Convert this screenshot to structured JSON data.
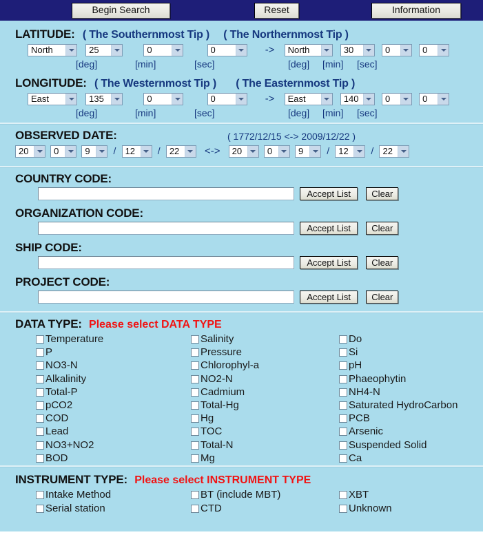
{
  "toolbar": {
    "begin_search": "Begin Search",
    "reset": "Reset",
    "information": "Information"
  },
  "latitude": {
    "label": "LATITUDE:",
    "from_tip": "( The Southernmost Tip )",
    "to_tip": "( The Northernmost Tip )",
    "arrow": "->",
    "from": {
      "hemisphere": "North",
      "deg": "25",
      "min": "0",
      "sec": "0"
    },
    "to": {
      "hemisphere": "North",
      "deg": "30",
      "min": "0",
      "sec": "0"
    },
    "units": {
      "deg": "[deg]",
      "min": "[min]",
      "sec": "[sec]"
    }
  },
  "longitude": {
    "label": "LONGITUDE:",
    "from_tip": "( The Westernmost Tip )",
    "to_tip": "( The Easternmost Tip )",
    "arrow": "->",
    "from": {
      "hemisphere": "East",
      "deg": "135",
      "min": "0",
      "sec": "0"
    },
    "to": {
      "hemisphere": "East",
      "deg": "140",
      "min": "0",
      "sec": "0"
    },
    "units": {
      "deg": "[deg]",
      "min": "[min]",
      "sec": "[sec]"
    }
  },
  "observed_date": {
    "label": "OBSERVED DATE:",
    "range_note": "( 1772/12/15 <-> 2009/12/22 )",
    "separator": "<->",
    "slash": "/",
    "from": {
      "y1": "20",
      "y2": "0",
      "y3": "9",
      "month": "12",
      "day": "22"
    },
    "to": {
      "y1": "20",
      "y2": "0",
      "y3": "9",
      "month": "12",
      "day": "22"
    }
  },
  "codes": [
    {
      "label": "COUNTRY CODE:",
      "value": "",
      "accept": "Accept List",
      "clear": "Clear"
    },
    {
      "label": "ORGANIZATION CODE:",
      "value": "",
      "accept": "Accept List",
      "clear": "Clear"
    },
    {
      "label": "SHIP CODE:",
      "value": "",
      "accept": "Accept List",
      "clear": "Clear"
    },
    {
      "label": "PROJECT CODE:",
      "value": "",
      "accept": "Accept List",
      "clear": "Clear"
    }
  ],
  "data_type": {
    "label": "DATA TYPE:",
    "hint": "Please select DATA TYPE",
    "col1": [
      "Temperature",
      "P",
      "NO3-N",
      "Alkalinity",
      "Total-P",
      "pCO2",
      "COD",
      "Lead",
      "NO3+NO2",
      "BOD"
    ],
    "col2": [
      "Salinity",
      "Pressure",
      "Chlorophyl-a",
      "NO2-N",
      "Cadmium",
      "Total-Hg",
      "Hg",
      "TOC",
      "Total-N",
      "Mg"
    ],
    "col3": [
      "Do",
      "Si",
      "pH",
      "Phaeophytin",
      "NH4-N",
      "Saturated HydroCarbon",
      "PCB",
      "Arsenic",
      "Suspended Solid",
      "Ca"
    ]
  },
  "instrument_type": {
    "label": "INSTRUMENT TYPE:",
    "hint": "Please select INSTRUMENT TYPE",
    "col1": [
      "Intake Method",
      "Serial station"
    ],
    "col2": [
      "BT (include MBT)",
      "CTD"
    ],
    "col3": [
      "XBT",
      "Unknown"
    ]
  },
  "colors": {
    "toolbar_bg": "#1e1e78",
    "form_bg": "#aadcec",
    "tip_text": "#16387f",
    "hint_red": "#f01414"
  }
}
